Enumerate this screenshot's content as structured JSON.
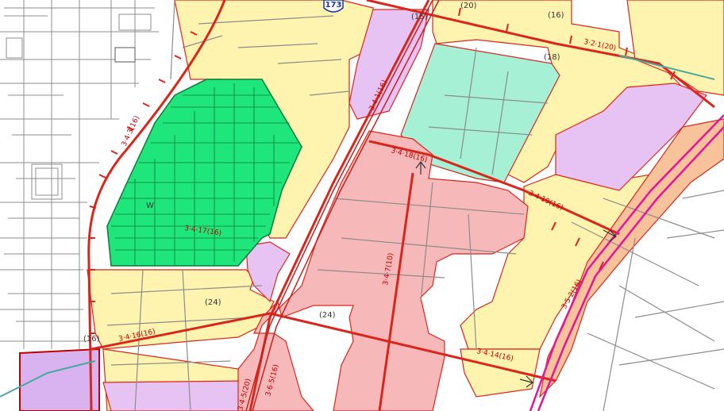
{
  "map": {
    "route_shield": "173",
    "colors": {
      "residential_yellow": "#fff3b0",
      "commercial_pink": "#f6b8b8",
      "institutional_mint": "#a6f0d6",
      "residential_green": "#1fe67a",
      "mixed_lavender": "#e6c3f2",
      "industrial_purple": "#d9b3ef",
      "orange_strip": "#f8c29b",
      "boundary_red": "#d9261c",
      "street_gray": "#8c8c8c",
      "rail_magenta": "#e2169a"
    },
    "road_labels": [
      "(15)",
      "(24)",
      "(24)",
      "(18)",
      "(16)",
      "(20)",
      "(16)",
      "3·4·18(16)",
      "3·4·7(10)",
      "3·4·17(16)",
      "3·4·14(16)",
      "3·4·16(16)",
      "3·4·3(16)",
      "3·4·19(16)",
      "3·5·2(16)",
      "3·2·1(20)",
      "3·4·1(16)",
      "3·6·5(16)",
      "3·4·5(20)",
      "W"
    ]
  }
}
